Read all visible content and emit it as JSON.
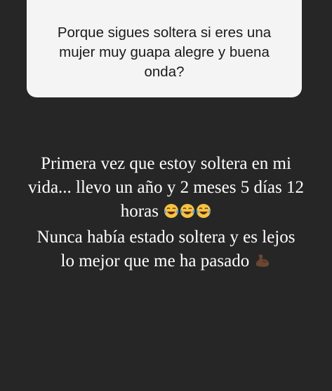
{
  "question": {
    "text": "Porque sigues soltera si eres una mujer muy guapa alegre y buena onda?"
  },
  "answer": {
    "line1": "Primera vez que estoy soltera en mi",
    "line2": "vida... llevo un año y 2 meses 5 días 12",
    "line3": "horas",
    "line4": "Nunca había estado soltera y es lejos",
    "line5": "lo mejor que me ha pasado",
    "emojis_line3": [
      "laughing-tears-emoji",
      "laughing-tears-emoji",
      "laughing-tears-emoji"
    ],
    "emoji_line5": "flexed-biceps-emoji"
  },
  "colors": {
    "background": "#262626",
    "card": "#f4f4f4",
    "question_text": "#1a1a1a",
    "answer_text": "#ffffff",
    "emoji_face": "#f6c243",
    "emoji_tear": "#4aa6e8",
    "biceps": "#6b4630"
  }
}
